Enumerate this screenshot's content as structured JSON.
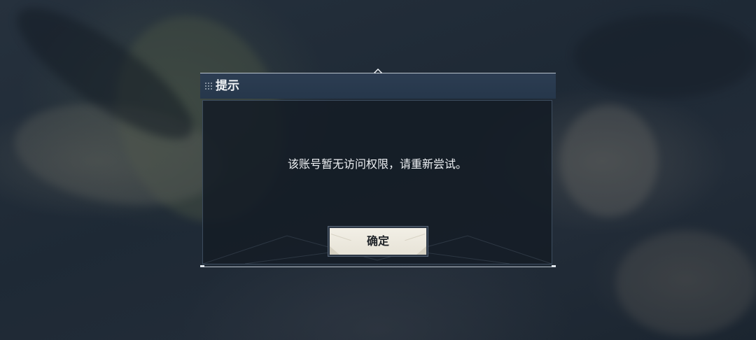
{
  "dialog": {
    "title": "提示",
    "message": "该账号暂无访问权限，请重新尝试。",
    "confirm_label": "确定"
  },
  "icons": {
    "drag_handle": "grip-dots-icon",
    "top_ornament": "diamond-ornament-icon"
  },
  "colors": {
    "header_bg": "#2c3d52",
    "body_bg": "#141c26",
    "button_bg": "#f2efe6",
    "text_light": "#eef1f4",
    "text_dark": "#1f2328"
  }
}
